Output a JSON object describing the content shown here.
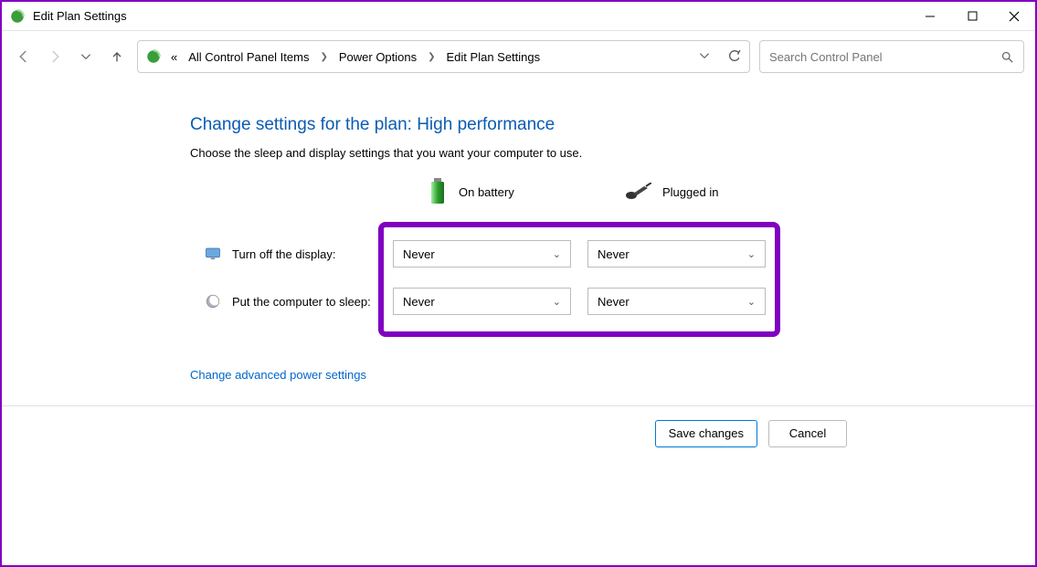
{
  "window": {
    "title": "Edit Plan Settings"
  },
  "breadcrumb": {
    "prefix": "«",
    "items": [
      "All Control Panel Items",
      "Power Options",
      "Edit Plan Settings"
    ]
  },
  "search": {
    "placeholder": "Search Control Panel"
  },
  "page": {
    "heading": "Change settings for the plan: High performance",
    "subheading": "Choose the sleep and display settings that you want your computer to use.",
    "columns": {
      "battery": "On battery",
      "plugged": "Plugged in"
    },
    "rows": {
      "display": {
        "label": "Turn off the display:",
        "battery_value": "Never",
        "plugged_value": "Never"
      },
      "sleep": {
        "label": "Put the computer to sleep:",
        "battery_value": "Never",
        "plugged_value": "Never"
      }
    },
    "advanced_link": "Change advanced power settings"
  },
  "footer": {
    "save": "Save changes",
    "cancel": "Cancel"
  }
}
